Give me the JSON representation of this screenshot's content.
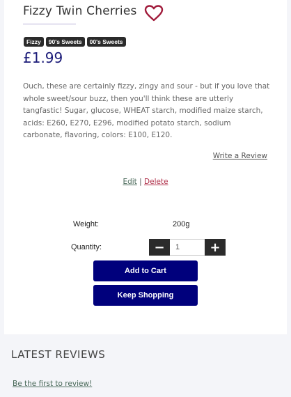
{
  "product": {
    "title": "Fizzy Twin Cherries",
    "tags": [
      "Fizzy",
      "90's Sweets",
      "00's Sweets"
    ],
    "price": "£1.99",
    "description": "Ouch, these are certainly fizzy, zingy and sour - but if you love that whole sweet/sour buzz, then you'll think these are utterly tangfastic! Sugar, glucose, WHEAT starch, modified maize starch, acids: E260, E270, E296, modified potato starch, sodium carbonate, flavoring, colors: E100, E120."
  },
  "actions": {
    "write_review": "Write a Review",
    "edit": "Edit",
    "separator": "|",
    "delete": "Delete"
  },
  "details": {
    "weight_label": "Weight:",
    "weight_value": "200g",
    "quantity_label": "Quantity:",
    "quantity_value": "1",
    "minus": "−",
    "plus": "+"
  },
  "buttons": {
    "add_to_cart": "Add to Cart",
    "keep_shopping": "Keep Shopping"
  },
  "reviews": {
    "heading": "LATEST REVIEWS",
    "empty_link": "Be the first to review!"
  },
  "icons": {
    "favorite": "heart-icon"
  },
  "colors": {
    "accent": "#00007c",
    "price": "#1a1a78",
    "heart": "#a01a3a",
    "delete": "#b0304a"
  }
}
